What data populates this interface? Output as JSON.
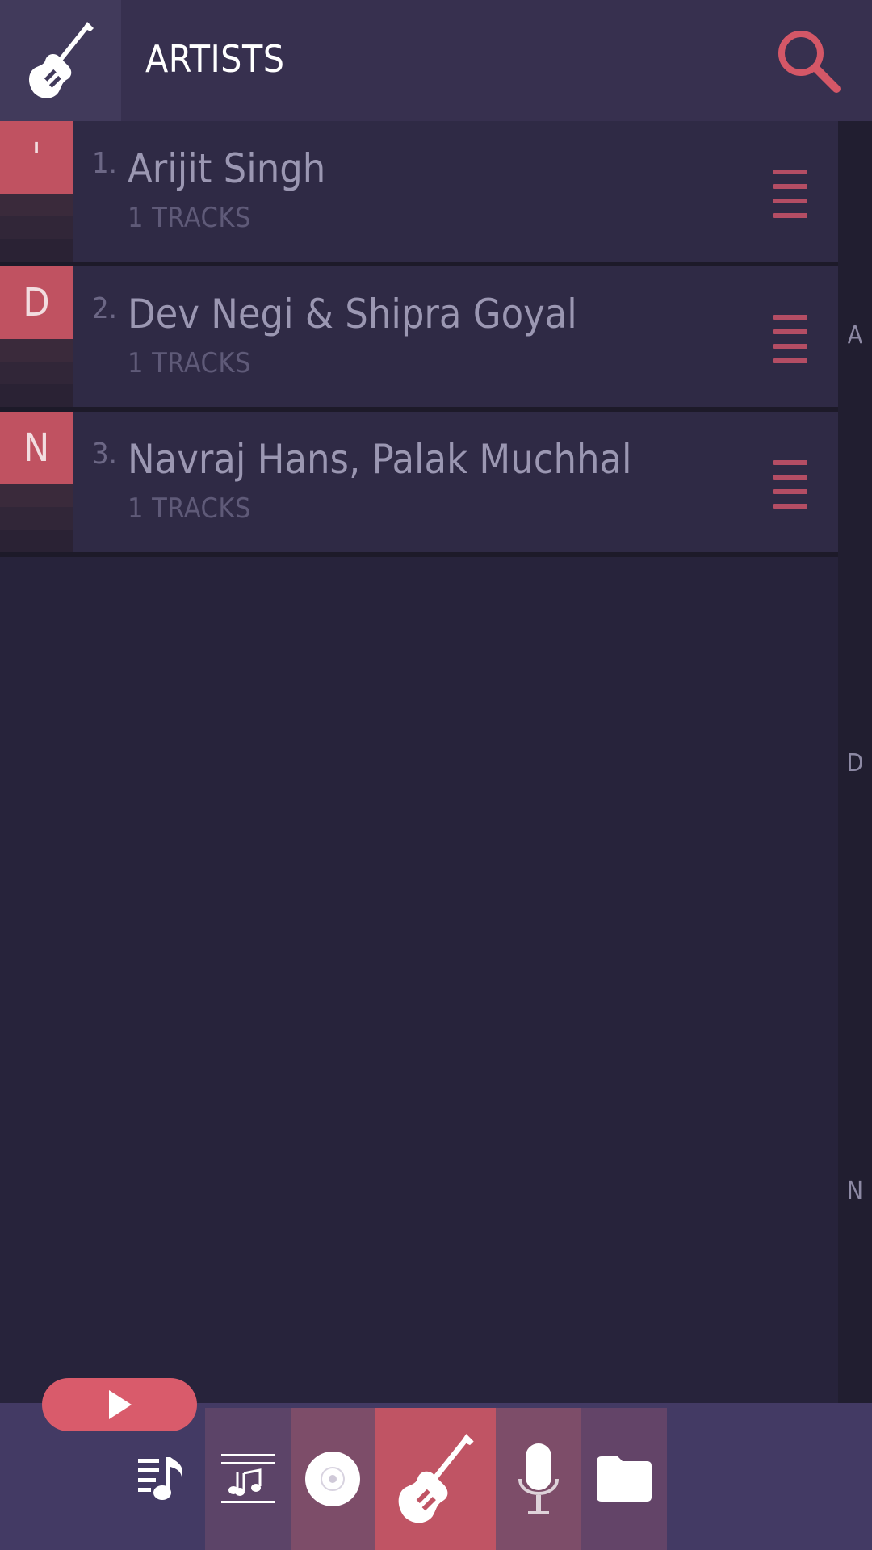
{
  "header": {
    "title": "ARTISTS",
    "app_icon": "guitar-icon",
    "search_icon": "search-icon"
  },
  "artists": [
    {
      "letter": "'",
      "number": "1.",
      "name": "Arijit Singh",
      "tracks": "1 TRACKS"
    },
    {
      "letter": "D",
      "number": "2.",
      "name": "Dev Negi & Shipra Goyal",
      "tracks": "1 TRACKS"
    },
    {
      "letter": "N",
      "number": "3.",
      "name": "Navraj Hans, Palak Muchhal",
      "tracks": "1 TRACKS"
    }
  ],
  "index_bar": [
    "A",
    "D",
    "N"
  ],
  "bottom_nav": [
    {
      "name": "now-playing-queue",
      "icon": "queue-music-icon"
    },
    {
      "name": "tracks",
      "icon": "lyrics-music-icon"
    },
    {
      "name": "albums",
      "icon": "disc-icon"
    },
    {
      "name": "artists",
      "icon": "guitar-icon",
      "active": true
    },
    {
      "name": "genres",
      "icon": "microphone-icon"
    },
    {
      "name": "folders",
      "icon": "folder-icon"
    }
  ],
  "colors": {
    "accent": "#d95b6b",
    "header_bg": "#37304f",
    "list_bg": "#27233b",
    "card_bg": "#2f2a45",
    "bottom_bg": "#433a64"
  }
}
